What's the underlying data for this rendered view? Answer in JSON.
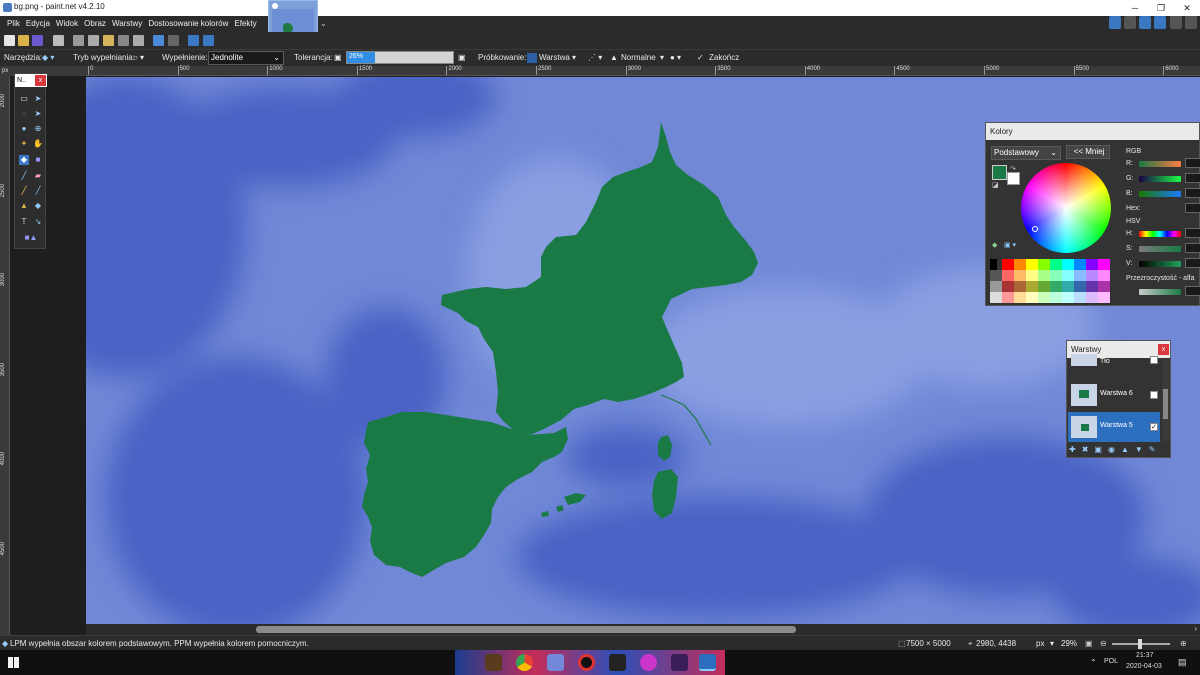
{
  "window": {
    "title": "bg.png - paint.net v4.2.10"
  },
  "menu": [
    "Plik",
    "Edycja",
    "Widok",
    "Obraz",
    "Warstwy",
    "Dostosowanie kolorów",
    "Efekty"
  ],
  "options": {
    "tools_label": "Narzędzia:",
    "fill_mode_label": "Tryb wypełniania:",
    "fill_label": "Wypełnienie:",
    "fill_value": "Jednolite",
    "tolerance_label": "Tolerancja:",
    "tolerance_value": "26%",
    "tolerance_fraction": 0.26,
    "sampling_label": "Próbkowanie:",
    "sampling_value": "Warstwa",
    "blend_value": "Normalne",
    "finish_label": "Zakończ"
  },
  "ruler": {
    "unit": "px",
    "h_ticks": [
      "0",
      "500",
      "1000",
      "1500",
      "2000",
      "2500",
      "3000",
      "3500",
      "4000",
      "4500",
      "5000",
      "5500",
      "6000"
    ],
    "v_ticks": [
      "2000",
      "2500",
      "3000",
      "3500",
      "4000",
      "4500"
    ]
  },
  "tools_panel": {
    "title": "N..",
    "close": "x"
  },
  "colors_panel": {
    "title": "Kolory",
    "palette_select": "Podstawowy",
    "less_button": "<< Mniej",
    "rgb_label": "RGB",
    "r": "R:",
    "g": "G:",
    "b": "B:",
    "hex_label": "Hex:",
    "hsv_label": "HSV",
    "h": "H:",
    "s": "S:",
    "v": "V:",
    "alpha_label": "Przezroczystość - alfa",
    "primary_color": "#1a7a45",
    "secondary_color": "#ffffff"
  },
  "layers_panel": {
    "title": "Warstwy",
    "close": "x",
    "layers": [
      {
        "name": "Tło",
        "checked": false
      },
      {
        "name": "Warstwa 6",
        "checked": false
      },
      {
        "name": "Warstwa 5",
        "checked": true
      }
    ]
  },
  "status": {
    "hint": "LPM wypełnia obszar kolorem podstawowym. PPM wypełnia kolorem pomocniczym.",
    "image_size": "7500 × 5000",
    "cursor_pos": "2980, 4438",
    "unit": "px",
    "zoom": "29%"
  },
  "taskbar": {
    "lang": "POL",
    "time": "21:37",
    "date": "2020-04-03"
  },
  "colors": {
    "sea": "#7088d6",
    "deep_sea": "#4a62c4",
    "land": "#1a7a45",
    "accent": "#2f8ee3"
  }
}
